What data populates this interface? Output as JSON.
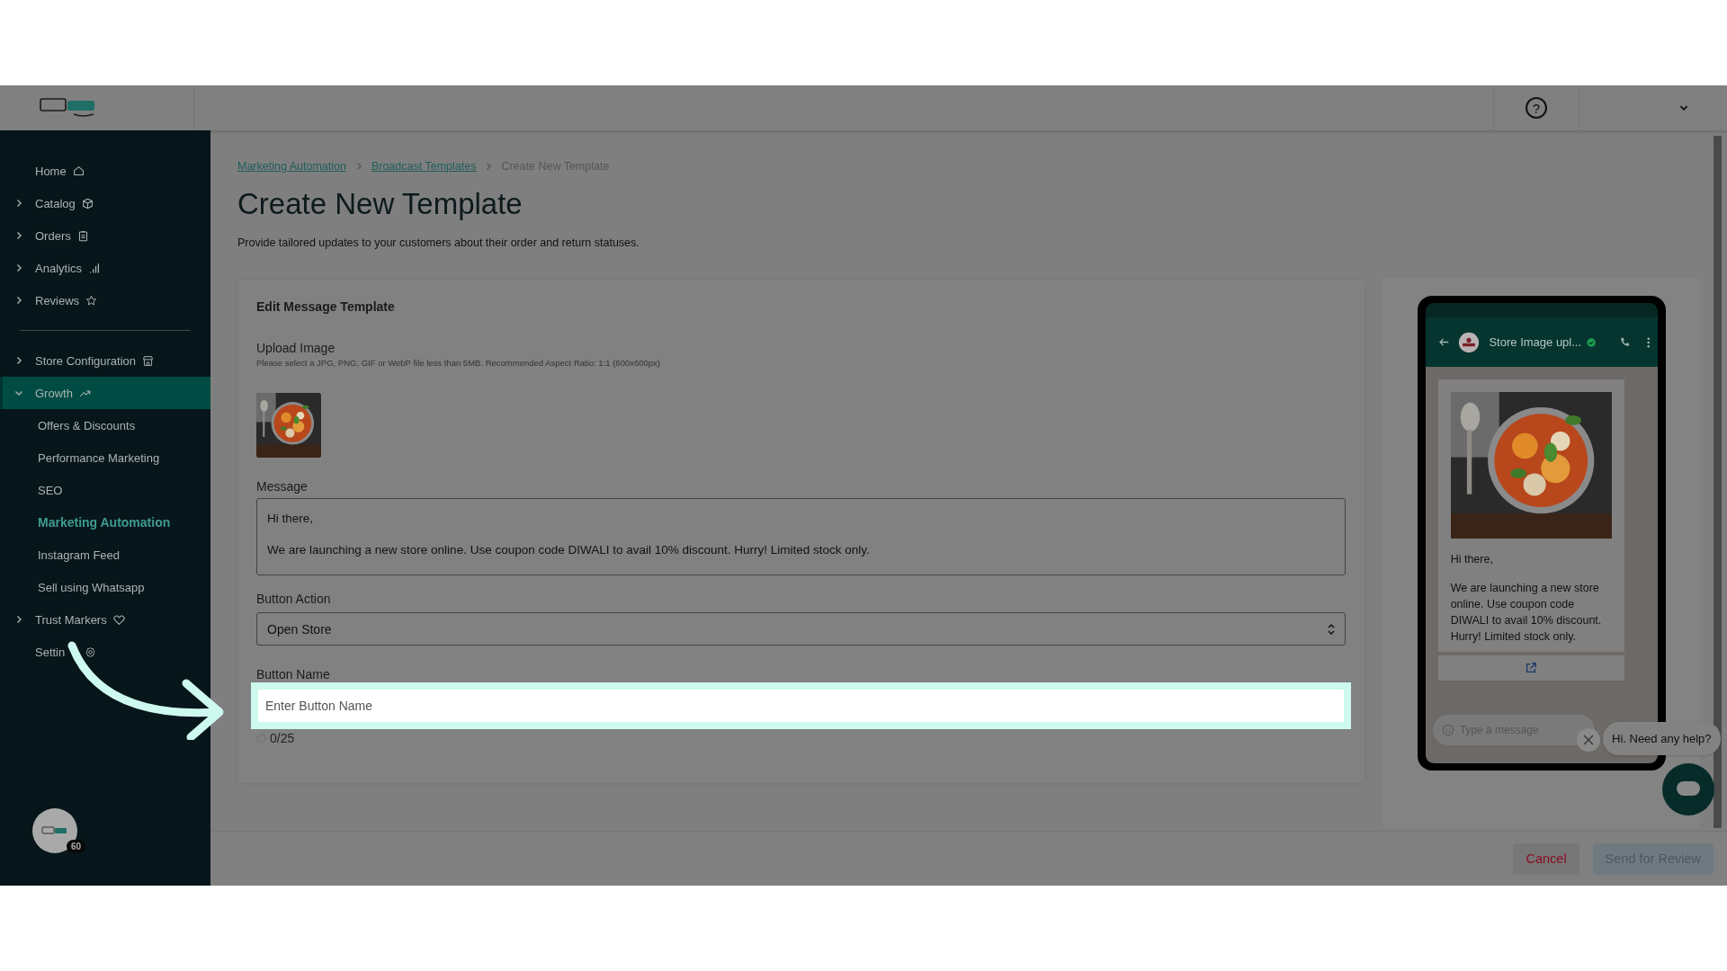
{
  "header": {
    "help": "?"
  },
  "sidebar": {
    "groups": [
      {
        "items": [
          {
            "label": "Home",
            "expandable": false,
            "selected": false
          },
          {
            "label": "Catalog",
            "expandable": true,
            "expanded": false,
            "selected": false
          },
          {
            "label": "Orders",
            "expandable": true,
            "expanded": false,
            "selected": false
          },
          {
            "label": "Analytics",
            "expandable": true,
            "expanded": false,
            "selected": false
          },
          {
            "label": "Reviews",
            "expandable": true,
            "expanded": false,
            "selected": false
          }
        ]
      },
      {
        "items": [
          {
            "label": "Store Configuration",
            "expandable": true,
            "expanded": false,
            "selected": false
          },
          {
            "label": "Growth",
            "expandable": true,
            "expanded": true,
            "selected": true,
            "children": [
              {
                "label": "Offers & Discounts",
                "selected": false
              },
              {
                "label": "Performance Marketing",
                "selected": false
              },
              {
                "label": "SEO",
                "selected": false
              },
              {
                "label": "Marketing Automation",
                "selected": true
              },
              {
                "label": "Instagram Feed",
                "selected": false
              },
              {
                "label": "Sell using Whatsapp",
                "selected": false
              }
            ]
          },
          {
            "label": "Trust Markers",
            "expandable": true,
            "expanded": false,
            "selected": false
          },
          {
            "label": "Settin",
            "expandable": false,
            "selected": false
          }
        ]
      }
    ],
    "avatar_badge": "60"
  },
  "breadcrumb": [
    "Marketing Automation",
    "Broadcast Templates",
    "Create New Template"
  ],
  "page": {
    "title": "Create New Template",
    "description": "Provide tailored updates to your customers about their order and return statuses."
  },
  "form": {
    "title": "Edit Message Template",
    "upload": {
      "label": "Upload Image",
      "hint": "Please select a JPG, PNG, GIF or WebP file less than 5MB. Recommended Aspect Ratio: 1:1 (600x600px)"
    },
    "message": {
      "label": "Message",
      "lines": [
        "Hi there,",
        "We are launching a new store online. Use coupon code DIWALI to avail 10% discount. Hurry! Limited stock only."
      ]
    },
    "button_action": {
      "label": "Button Action",
      "value": "Open Store"
    },
    "button_name": {
      "label": "Button Name",
      "placeholder": "Enter Button Name",
      "counter": "0/25",
      "highlighted": true
    }
  },
  "preview": {
    "contact": "Store Image upl...",
    "verified": true,
    "lines": [
      "Hi there,",
      "We are launching a new store online. Use coupon code DIWALI to avail 10% discount. Hurry! Limited stock only."
    ],
    "input_placeholder": "Type a message"
  },
  "help_bubble": "Hi. Need any help?",
  "footer": {
    "buttons": [
      {
        "label": "Cancel",
        "kind": "secondary",
        "disabled": false
      },
      {
        "label": "Send for Review",
        "kind": "primary",
        "disabled": true
      }
    ]
  }
}
